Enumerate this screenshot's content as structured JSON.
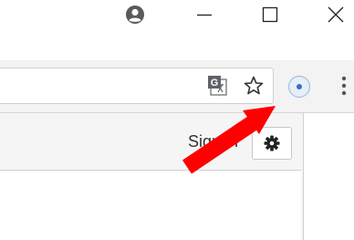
{
  "window": {
    "controls": [
      "account-icon",
      "minimize-icon",
      "maximize-icon",
      "close-icon"
    ]
  },
  "toolbar": {
    "omnibox_value": "",
    "icons": [
      "translate-icon",
      "bookmark-star-icon",
      "extension-icon",
      "menu-icon"
    ]
  },
  "page": {
    "signin_label": "Sign in",
    "settings_icon": "gear-icon"
  },
  "annotation": {
    "arrow_color": "#ff0000"
  }
}
